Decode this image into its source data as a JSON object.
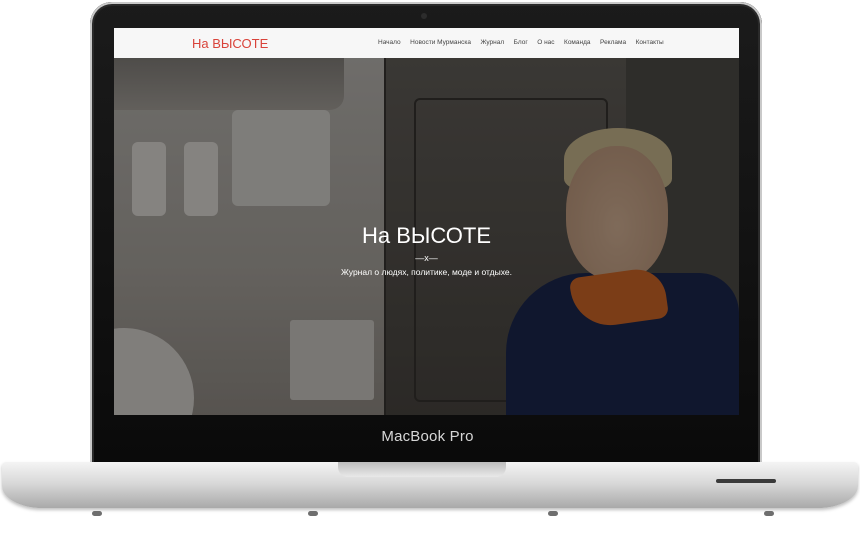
{
  "device": {
    "label": "MacBook Pro"
  },
  "site": {
    "logo": "На ВЫСОТЕ",
    "accent_color": "#d9433a",
    "menu": [
      "Начало",
      "Новости Мурманска",
      "Журнал",
      "Блог",
      "О нас",
      "Команда",
      "Реклама",
      "Контакты"
    ]
  },
  "hero": {
    "title": "На ВЫСОТЕ",
    "divider": "—x—",
    "subtitle": "Журнал о людях, политике, моде и отдыхе.",
    "scroll_icon": "double-chevron-down-icon"
  }
}
